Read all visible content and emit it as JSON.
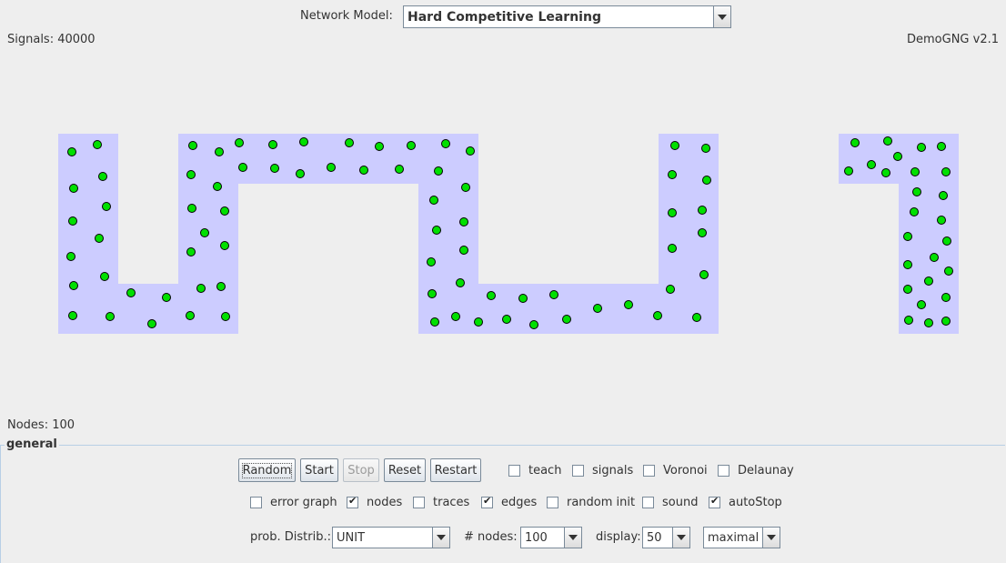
{
  "header": {
    "network_model_label": "Network Model:",
    "network_model_value": "Hard Competitive Learning",
    "signals_text": "Signals: 40000",
    "version_text": "DemoGNG v2.1",
    "nodes_text": "Nodes: 100"
  },
  "canvas": {
    "region_color": "#ccccff",
    "node_color": "#00e000",
    "node_count": 100
  },
  "panel": {
    "title": "general",
    "buttons": {
      "random": "Random",
      "start": "Start",
      "stop": "Stop",
      "reset": "Reset",
      "restart": "Restart"
    },
    "checkboxes": {
      "teach": {
        "label": "teach",
        "checked": false
      },
      "signals": {
        "label": "signals",
        "checked": false
      },
      "voronoi": {
        "label": "Voronoi",
        "checked": false
      },
      "delaunay": {
        "label": "Delaunay",
        "checked": false
      },
      "error_graph": {
        "label": "error graph",
        "checked": false
      },
      "nodes": {
        "label": "nodes",
        "checked": true
      },
      "traces": {
        "label": "traces",
        "checked": false
      },
      "edges": {
        "label": "edges",
        "checked": true
      },
      "random_init": {
        "label": "random init",
        "checked": false
      },
      "sound": {
        "label": "sound",
        "checked": false
      },
      "auto_stop": {
        "label": "autoStop",
        "checked": true
      }
    },
    "prob_distrib": {
      "label": "prob. Distrib.:",
      "value": "UNIT"
    },
    "num_nodes": {
      "label": "# nodes:",
      "value": "100"
    },
    "display": {
      "label": "display:",
      "value": "50"
    },
    "speed": {
      "value": "maximal"
    }
  }
}
